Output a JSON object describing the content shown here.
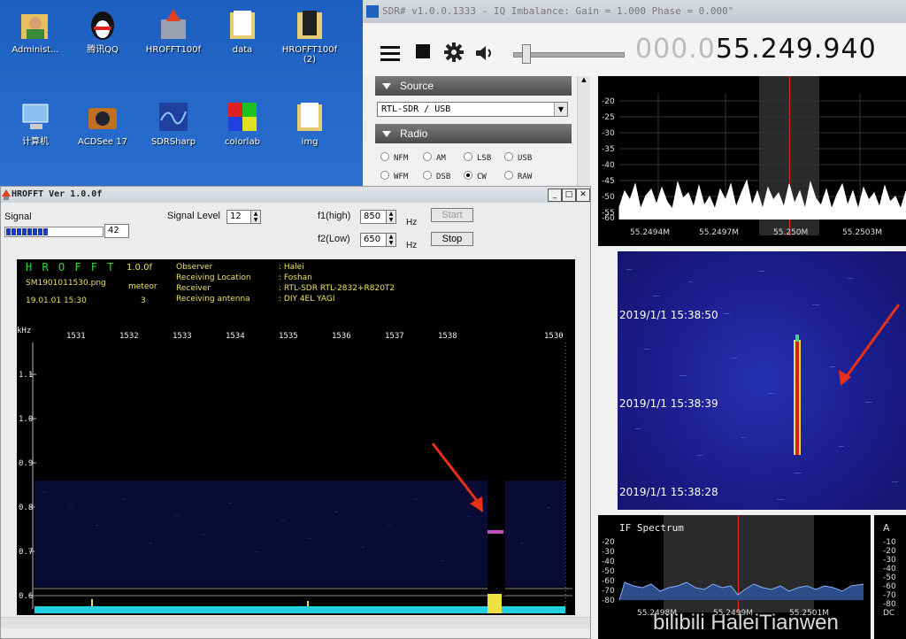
{
  "desktop": {
    "icons": [
      {
        "label": "Administ..."
      },
      {
        "label": "腾讯QQ"
      },
      {
        "label": "HROFFT100f"
      },
      {
        "label": "data"
      },
      {
        "label": "HROFFT100f\n(2)"
      },
      {
        "label": "计算机"
      },
      {
        "label": "ACDSee 17"
      },
      {
        "label": "SDRSharp"
      },
      {
        "label": "colorlab"
      },
      {
        "label": "img"
      }
    ]
  },
  "sdr": {
    "title": "SDR# v1.0.0.1333 - IQ Imbalance: Gain = 1.000 Phase = 0.000°",
    "freq_dim": "000.0",
    "freq_main": "55.249.940",
    "source": {
      "header": "Source",
      "device": "RTL-SDR / USB"
    },
    "radio": {
      "header": "Radio",
      "modes": [
        {
          "label": "NFM",
          "selected": false
        },
        {
          "label": "AM",
          "selected": false
        },
        {
          "label": "LSB",
          "selected": false
        },
        {
          "label": "USB",
          "selected": false
        },
        {
          "label": "WFM",
          "selected": false
        },
        {
          "label": "DSB",
          "selected": false
        },
        {
          "label": "CW",
          "selected": true
        },
        {
          "label": "RAW",
          "selected": false
        }
      ]
    },
    "spectrum": {
      "y_ticks": [
        "-20",
        "-25",
        "-30",
        "-35",
        "-40",
        "-45",
        "-50",
        "-55",
        "-60"
      ],
      "x_ticks": [
        "55.2494M",
        "55.2497M",
        "55.250M",
        "55.2503M"
      ]
    },
    "waterfall": {
      "timestamps": [
        "2019/1/1 15:38:50",
        "2019/1/1 15:38:39",
        "2019/1/1 15:38:28"
      ]
    },
    "if_spectrum": {
      "title": "IF Spectrum",
      "y_ticks": [
        "-20",
        "-30",
        "-40",
        "-50",
        "-60",
        "-70",
        "-80"
      ],
      "x_ticks": [
        "55.2498M",
        "55.2499M",
        "55.2501M"
      ],
      "right_y_ticks": [
        "-10",
        "-20",
        "-30",
        "-40",
        "-50",
        "-60",
        "-70",
        "-80"
      ],
      "right_label": "A",
      "right_bottom": "DC"
    }
  },
  "hrofft": {
    "title": "HROFFT  Ver 1.0.0f",
    "signal_label": "Signal",
    "signal_value": "42",
    "signal_level_label": "Signal Level",
    "signal_level_value": "12",
    "f1_label": "f1(high)",
    "f1_value": "850",
    "f2_label": "f2(Low)",
    "f2_value": "650",
    "hz": "Hz",
    "start_label": "Start",
    "stop_label": "Stop",
    "plot": {
      "app_name": "H R O F F T",
      "version": "1.0.0f",
      "filename": "SM1901011530.png",
      "meteor_label": "meteor",
      "meteor_count": "3",
      "datetime": "19.01.01 15:30",
      "info_keys": [
        "Observer",
        "Receiving Location",
        "Receiver",
        "Receiving antenna"
      ],
      "info_values": [
        ": Halei",
        ": Foshan",
        ": RTL-SDR RTL-2832+R820T2",
        ": DIY 4EL YAGI"
      ],
      "khz_label": "kHz",
      "y_ticks": [
        "1.1",
        "1.0",
        "0.9",
        "0.8",
        "0.7",
        "0.6"
      ],
      "x_ticks": [
        "1531",
        "1532",
        "1533",
        "1534",
        "1535",
        "1536",
        "1537",
        "1538",
        "1530"
      ]
    }
  },
  "watermark": "bilibili HaleiTianwen",
  "colors": {
    "accent_red": "#e03020",
    "plot_green": "#2bdb2b",
    "plot_yellow": "#f0e060",
    "waterfall_blue": "#1a1c8a"
  }
}
